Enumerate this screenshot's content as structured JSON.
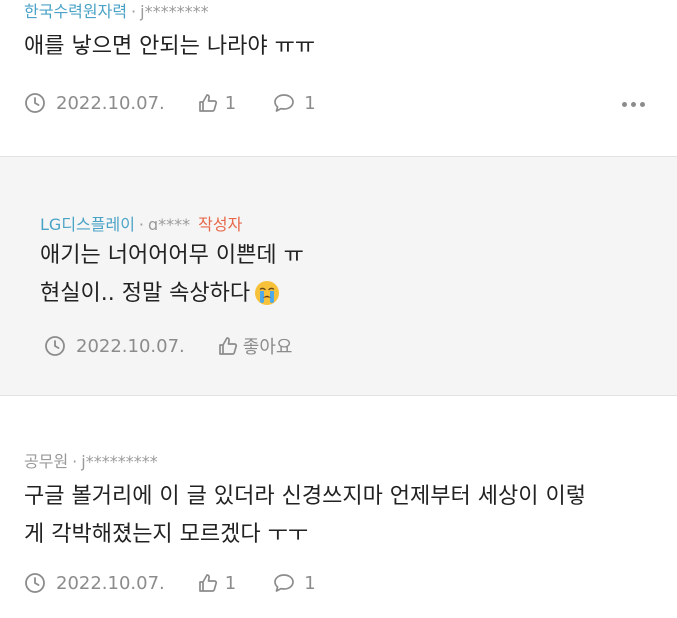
{
  "comments": [
    {
      "author": "한국수력원자력",
      "separator": "·",
      "user_id": "j********",
      "text_lines": [
        "애를 낳으면 안되는 나라야 ㅠㅠ"
      ],
      "date": "2022.10.07.",
      "likes": "1",
      "replies": "1"
    },
    {
      "author": "LG디스플레이",
      "separator": "·",
      "user_id": "ɑ****",
      "writer_badge": "작성자",
      "text_lines": [
        "애기는 너어어어무 이쁜데 ㅠ",
        "현실이.. 정말 속상하다"
      ],
      "emoji": "crying-face-icon",
      "date": "2022.10.07.",
      "like_label": "좋아요"
    },
    {
      "author": "공무원",
      "separator": "·",
      "user_id": "j*********",
      "text_lines": [
        "구글 볼거리에 이 글 있더라 신경쓰지마 언제부터 세상이 이렇",
        "게 각박해졌는지 모르겠다 ㅜㅜ"
      ],
      "date": "2022.10.07.",
      "likes": "1",
      "replies": "1"
    }
  ],
  "icons": {
    "clock": "clock-icon",
    "like": "thumbs-up-icon",
    "reply": "speech-bubble-icon",
    "more": "more-dots-icon"
  },
  "colors": {
    "author_link": "#4aa3c7",
    "writer_badge": "#e8694a",
    "meta_gray": "#9a9a9a",
    "reply_background": "#f5f5f5"
  }
}
